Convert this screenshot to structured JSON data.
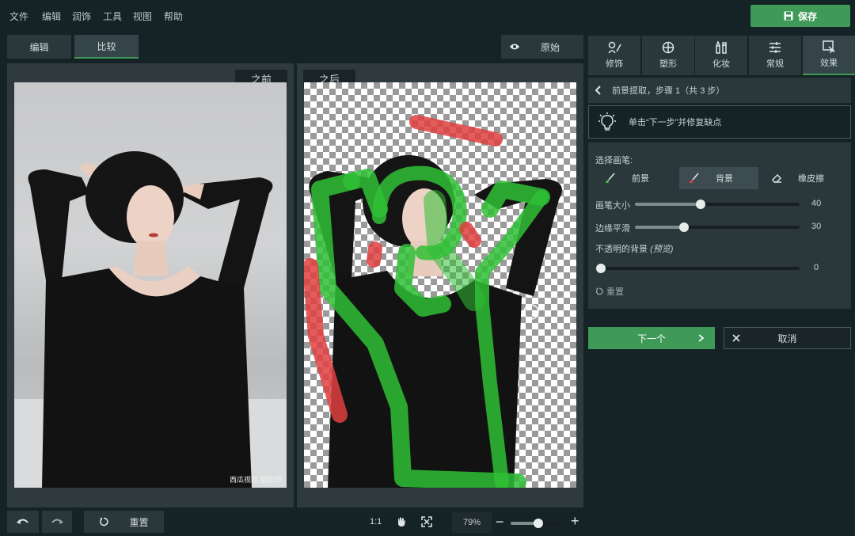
{
  "menu": [
    "文件",
    "编辑",
    "润饰",
    "工具",
    "视图",
    "帮助"
  ],
  "save_label": "保存",
  "view_tabs": {
    "edit": "编辑",
    "compare": "比较"
  },
  "original_label": "原始",
  "before_label": "之前",
  "after_label": "之后",
  "watermark": "西瓜视频·摄影师",
  "right_tabs": [
    "修饰",
    "塑形",
    "化妆",
    "常规",
    "效果"
  ],
  "step_text": "前景提取，步骤 1（共 3 步）",
  "hint_text": "单击“下一步”并修复缺点",
  "brush": {
    "title": "选择画笔:",
    "foreground": "前景",
    "background": "背景",
    "eraser": "橡皮擦"
  },
  "sliders": {
    "size": {
      "label": "画笔大小",
      "value": "40",
      "fraction": 0.4
    },
    "smooth": {
      "label": "边缘平滑",
      "value": "30",
      "fraction": 0.3
    },
    "opacity": {
      "label": "不透明的背景 ",
      "label_note": "(预览)",
      "value": "0",
      "fraction": 0.0
    }
  },
  "reset_label": "重置",
  "next_label": "下一个",
  "cancel_label": "取消",
  "bottom": {
    "reset_label": "重置",
    "ratio_label": "1:1",
    "zoom_value": "79%",
    "zoom_fraction": 0.5
  },
  "colors": {
    "accent": "#3f9a58",
    "keep_stroke": "#2fbf35",
    "remove_stroke": "#e04040"
  }
}
